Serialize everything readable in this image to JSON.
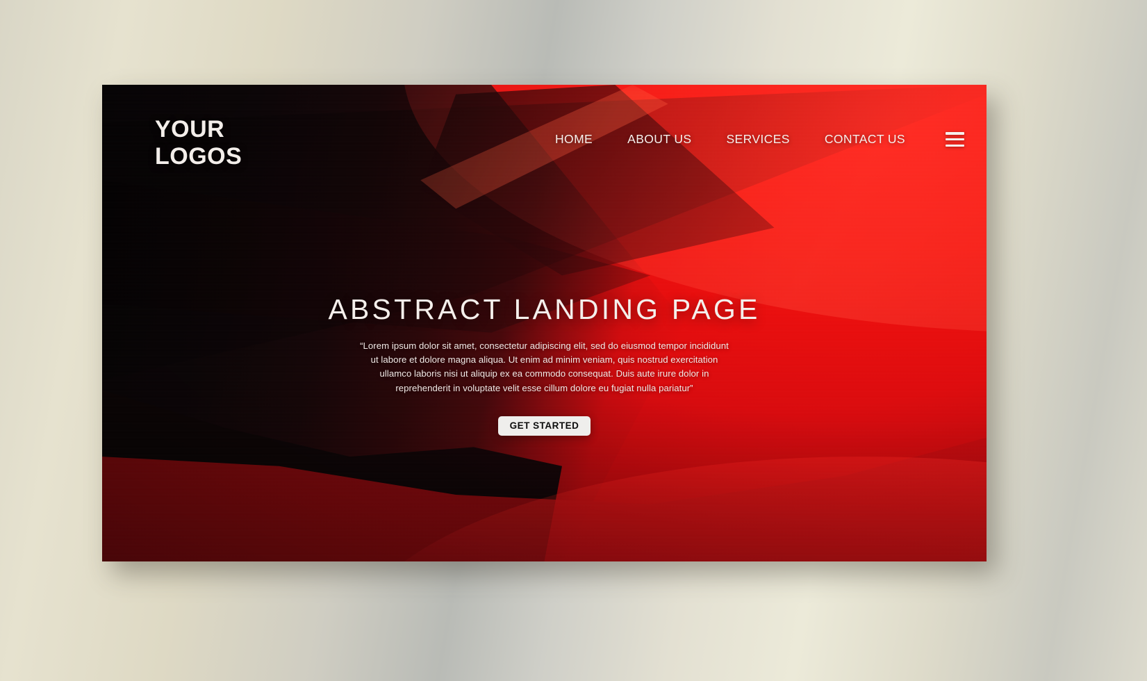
{
  "brand": {
    "logo_text": "YOUR\nLOGOS"
  },
  "nav": {
    "items": [
      {
        "label": "HOME"
      },
      {
        "label": "ABOUT US"
      },
      {
        "label": "SERVICES"
      },
      {
        "label": "CONTACT US"
      }
    ],
    "menu_icon": "hamburger-icon"
  },
  "hero": {
    "headline": "ABSTRACT LANDING PAGE",
    "paragraph": "“Lorem ipsum dolor sit amet, consectetur adipiscing elit, sed do eiusmod tempor incididunt ut labore et dolore magna aliqua. Ut enim ad minim veniam, quis nostrud exercitation ullamco laboris nisi ut aliquip ex ea commodo consequat. Duis aute irure dolor in reprehenderit in voluptate velit esse cillum dolore eu fugiat nulla pariatur”",
    "cta_label": "GET STARTED"
  },
  "colors": {
    "accent_red": "#f40f0c",
    "bright_red": "#ff1410",
    "dark": "#050203",
    "text_light": "#f3eeea",
    "cta_bg": "#efeeec",
    "cta_text": "#0d0d0d",
    "page_backdrop": "#ded9c4"
  }
}
